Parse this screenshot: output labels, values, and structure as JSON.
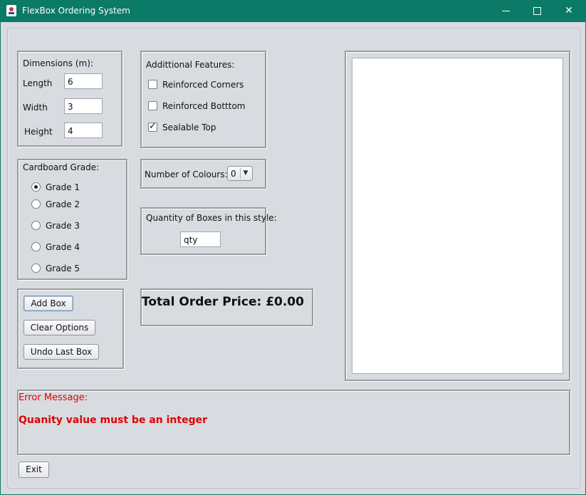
{
  "window": {
    "title": "FlexBox Ordering System"
  },
  "dimensions": {
    "heading": "Dimensions (m):",
    "length_label": "Length",
    "length_value": "6",
    "width_label": "Width",
    "width_value": "3",
    "height_label": "Height",
    "height_value": "4"
  },
  "features": {
    "heading": "Addittional Features:",
    "items": [
      {
        "label": "Reinforced Corners",
        "checked": false
      },
      {
        "label": "Reinforced Botttom",
        "checked": false
      },
      {
        "label": "Sealable Top",
        "checked": true
      }
    ]
  },
  "grade": {
    "heading": "Cardboard Grade:",
    "options": [
      "Grade 1",
      "Grade 2",
      "Grade 3",
      "Grade 4",
      "Grade 5"
    ],
    "selected": "Grade 1"
  },
  "colours": {
    "label": "Number of Colours:",
    "selected": "0"
  },
  "quantity": {
    "label": "Quantity of Boxes in this style:",
    "value": "qty"
  },
  "actions": {
    "add": "Add Box",
    "clear": "Clear Options",
    "undo": "Undo Last Box"
  },
  "total": {
    "text": "Total Order Price: £0.00"
  },
  "error": {
    "label": "Error Message:",
    "message": "Quanity value must be an integer",
    "color": "#e00000"
  },
  "exit_label": "Exit"
}
